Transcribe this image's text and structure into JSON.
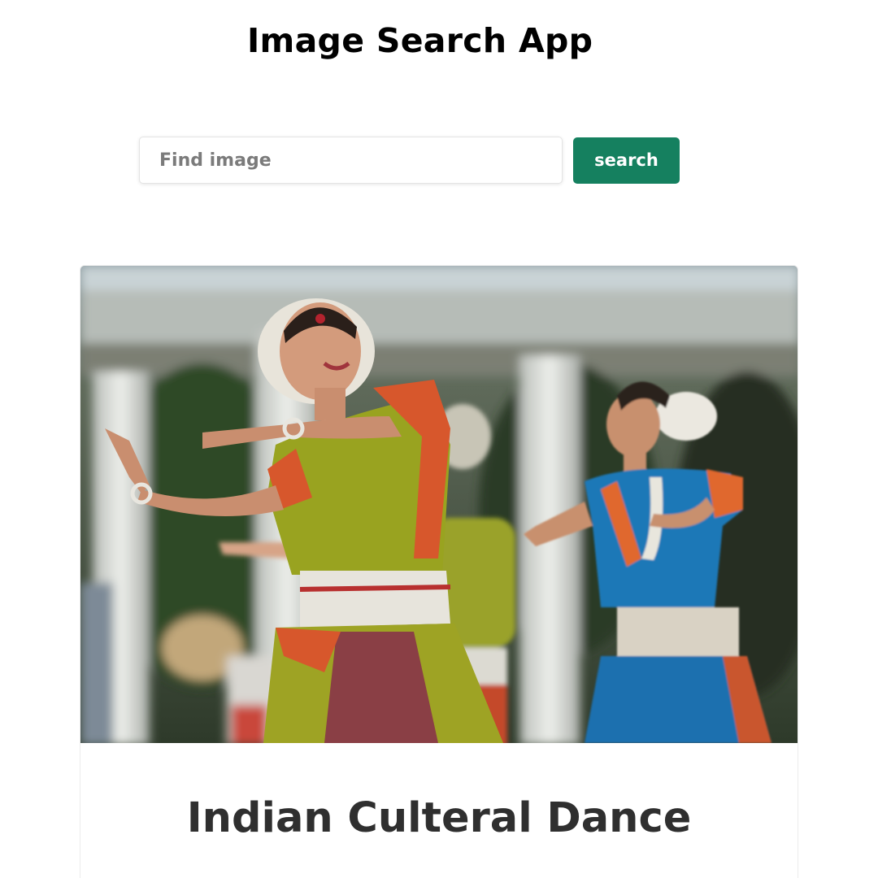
{
  "header": {
    "title": "Image Search App"
  },
  "search": {
    "placeholder": "Find image",
    "value": "",
    "button_label": "search",
    "button_color": "#15805f"
  },
  "results": [
    {
      "caption": "Indian Culteral Dance"
    }
  ]
}
